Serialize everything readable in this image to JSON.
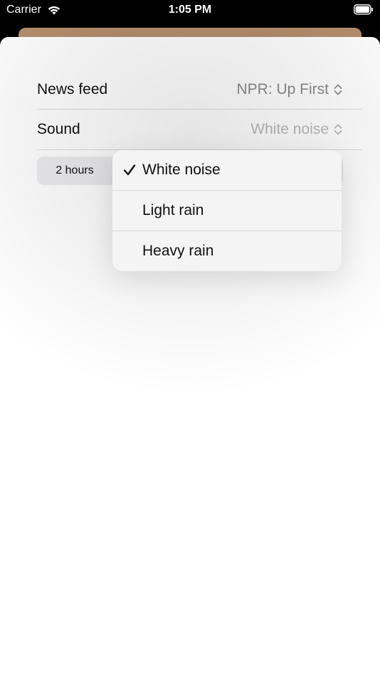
{
  "status_bar": {
    "carrier": "Carrier",
    "time": "1:05 PM"
  },
  "colors": {
    "accent_brown": "#b58f6f",
    "secondary_text": "#8a8a8e"
  },
  "rows": {
    "news_feed": {
      "label": "News feed",
      "value": "NPR: Up First"
    },
    "sound": {
      "label": "Sound",
      "value": "White noise"
    }
  },
  "segmented": {
    "selected_label": "2 hours"
  },
  "menu": {
    "items": [
      {
        "label": "White noise",
        "checked": true
      },
      {
        "label": "Light rain",
        "checked": false
      },
      {
        "label": "Heavy rain",
        "checked": false
      }
    ]
  },
  "icons": {
    "wifi": "wifi-icon",
    "battery": "battery-icon",
    "updown": "chevron-updown-icon",
    "check": "checkmark-icon"
  }
}
